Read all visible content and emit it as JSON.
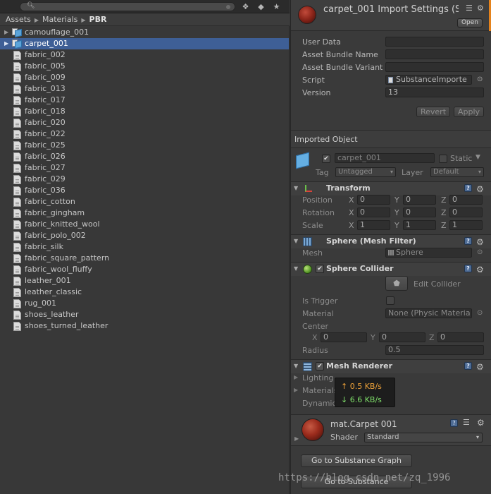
{
  "project": {
    "breadcrumb": [
      "Assets",
      "Materials",
      "PBR"
    ],
    "files": [
      {
        "name": "camouflage_001",
        "type": "substance",
        "expandable": true
      },
      {
        "name": "carpet_001",
        "type": "substance",
        "expandable": true,
        "selected": true
      },
      {
        "name": "fabric_002",
        "type": "doc"
      },
      {
        "name": "fabric_005",
        "type": "doc"
      },
      {
        "name": "fabric_009",
        "type": "doc"
      },
      {
        "name": "fabric_013",
        "type": "doc"
      },
      {
        "name": "fabric_017",
        "type": "doc"
      },
      {
        "name": "fabric_018",
        "type": "doc"
      },
      {
        "name": "fabric_020",
        "type": "doc"
      },
      {
        "name": "fabric_022",
        "type": "doc"
      },
      {
        "name": "fabric_025",
        "type": "doc"
      },
      {
        "name": "fabric_026",
        "type": "doc"
      },
      {
        "name": "fabric_027",
        "type": "doc"
      },
      {
        "name": "fabric_029",
        "type": "doc"
      },
      {
        "name": "fabric_036",
        "type": "doc"
      },
      {
        "name": "fabric_cotton",
        "type": "doc"
      },
      {
        "name": "fabric_gingham",
        "type": "doc"
      },
      {
        "name": "fabric_knitted_wool",
        "type": "doc"
      },
      {
        "name": "fabric_polo_002",
        "type": "doc"
      },
      {
        "name": "fabric_silk",
        "type": "doc"
      },
      {
        "name": "fabric_square_pattern",
        "type": "doc"
      },
      {
        "name": "fabric_wool_fluffy",
        "type": "doc"
      },
      {
        "name": "leather_001",
        "type": "doc"
      },
      {
        "name": "leather_classic",
        "type": "doc"
      },
      {
        "name": "rug_001",
        "type": "doc"
      },
      {
        "name": "shoes_leather",
        "type": "doc"
      },
      {
        "name": "shoes_turned_leather",
        "type": "doc"
      }
    ]
  },
  "inspector": {
    "title": "carpet_001 Import Settings (S",
    "open_label": "Open",
    "user_data_label": "User Data",
    "user_data_value": "",
    "bundle_name_label": "Asset Bundle Name",
    "bundle_name_value": "",
    "bundle_variant_label": "Asset Bundle Variant",
    "bundle_variant_value": "",
    "script_label": "Script",
    "script_value": "SubstanceImporte",
    "version_label": "Version",
    "version_value": "13",
    "revert_label": "Revert",
    "apply_label": "Apply",
    "imported_object_label": "Imported Object"
  },
  "game_object": {
    "name": "carpet_001",
    "static_label": "Static",
    "tag_label": "Tag",
    "tag_value": "Untagged",
    "layer_label": "Layer",
    "layer_value": "Default"
  },
  "transform": {
    "title": "Transform",
    "position_label": "Position",
    "rotation_label": "Rotation",
    "scale_label": "Scale",
    "axis_x": "X",
    "axis_y": "Y",
    "axis_z": "Z",
    "position": [
      "0",
      "0",
      "0"
    ],
    "rotation": [
      "0",
      "0",
      "0"
    ],
    "scale": [
      "1",
      "1",
      "1"
    ]
  },
  "mesh_filter": {
    "title": "Sphere (Mesh Filter)",
    "mesh_label": "Mesh",
    "mesh_value": "Sphere"
  },
  "sphere_collider": {
    "title": "Sphere Collider",
    "edit_label": "Edit Collider",
    "is_trigger_label": "Is Trigger",
    "material_label": "Material",
    "material_value": "None (Physic Materia",
    "center_label": "Center",
    "center": [
      "0",
      "0",
      "0"
    ],
    "radius_label": "Radius",
    "radius_value": "0.5"
  },
  "mesh_renderer": {
    "title": "Mesh Renderer",
    "lighting_label": "Lighting",
    "materials_label": "Materials",
    "dynamic_label": "Dynamic"
  },
  "network": {
    "up": "0.5 KB/s",
    "down": "6.6 KB/s"
  },
  "material": {
    "name": "mat.Carpet 001",
    "shader_label": "Shader",
    "shader_value": "Standard"
  },
  "buttons": {
    "substance_graph": "Go to Substance Graph",
    "substance": "Go to Substance"
  },
  "watermark": "https://blog.csdn.net/zq_1996",
  "colors": {
    "selection": "#3e5f96",
    "accent_orange": "#e4821c"
  }
}
